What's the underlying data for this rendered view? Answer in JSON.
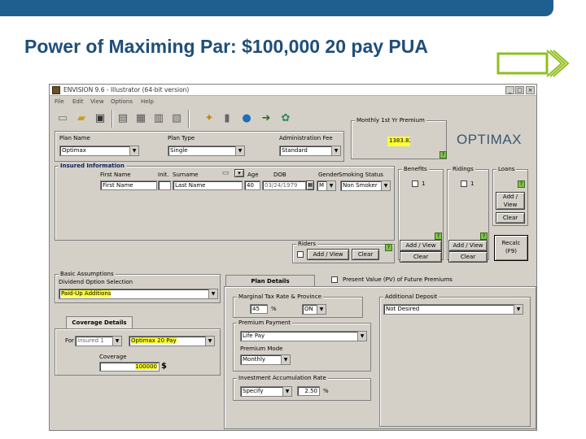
{
  "slide": {
    "title": "Power of Maximing Par: $100,000 20 pay PUA",
    "topbar_color": "#1f5f8f",
    "arrow_color": "#8fbf1f"
  },
  "window": {
    "title": "ENVISION 9.6 - Illustrator (64-bit version)",
    "controls": [
      "_",
      "□",
      "×"
    ]
  },
  "menu": [
    "File",
    "Edit",
    "View",
    "Options",
    "Help"
  ],
  "toolbar_icons": [
    "new-icon",
    "open-icon",
    "save-icon",
    "page-icon",
    "report-icon",
    "print-icon",
    "folder-icon",
    "stamp-icon",
    "wand-icon",
    "lock-icon",
    "globe-icon",
    "exit-icon",
    "settings-icon"
  ],
  "plan": {
    "plan_name_label": "Plan Name",
    "plan_name_value": "Optimax",
    "plan_type_label": "Plan Type",
    "plan_type_value": "Single",
    "admin_fee_label": "Administration Fee",
    "admin_fee_value": "Standard"
  },
  "premium": {
    "label": "Monthly 1st Yr Premium",
    "value": "1383.82",
    "logo": "OPTIMAX"
  },
  "insured": {
    "label": "Insured Information",
    "first_name_label": "First Name",
    "init_label": "Init.",
    "surname_label": "Surname",
    "age_label": "Age",
    "dob_label": "DOB",
    "gender_label": "Gender",
    "smoking_label": "Smoking Status",
    "first_name": "First Name",
    "init": "",
    "surname": "Last Name",
    "age": "40",
    "dob": "03/24/1979",
    "gender": "M",
    "smoking": "Non Smoker"
  },
  "side_groups": {
    "benefits_label": "Benefits",
    "benefits_count": "1",
    "riders_label": "Ridings",
    "riders_count": "1",
    "loans_label": "Loans",
    "add_view": "Add / View",
    "add_view_short": "Add / View",
    "clear": "Clear",
    "recalc": "Recalc",
    "recalc_key": "(F9)"
  },
  "riders": {
    "label": "Riders",
    "add_view": "Add / View",
    "clear": "Clear"
  },
  "basic": {
    "label": "Basic Assumptions",
    "dividend_label": "Dividend Option Selection",
    "dividend_value": "Paid-Up Additions"
  },
  "coverage": {
    "tab_label": "Coverage Details",
    "for_label": "For",
    "insured_value": "Insured 1",
    "plan_value": "Optimax 20 Pay",
    "coverage_label": "Coverage",
    "coverage_value": "100000",
    "currency": "$"
  },
  "plan_details": {
    "tab_label": "Plan Details",
    "pv_label": "Present Value (PV) of Future Premiums",
    "mtr_label": "Marginal Tax Rate & Province",
    "mtr_value": "45",
    "mtr_unit": "%",
    "province": "ON",
    "premium_payment_label": "Premium Payment",
    "premium_payment_value": "Life Pay",
    "premium_mode_label": "Premium Mode",
    "premium_mode_value": "Monthly",
    "iar_label": "Investment Accumulation Rate",
    "iar_value": "Specify",
    "iar_rate": "2.50",
    "iar_unit": "%",
    "additional_deposit_label": "Additional Deposit",
    "additional_deposit_value": "Not Desired"
  }
}
